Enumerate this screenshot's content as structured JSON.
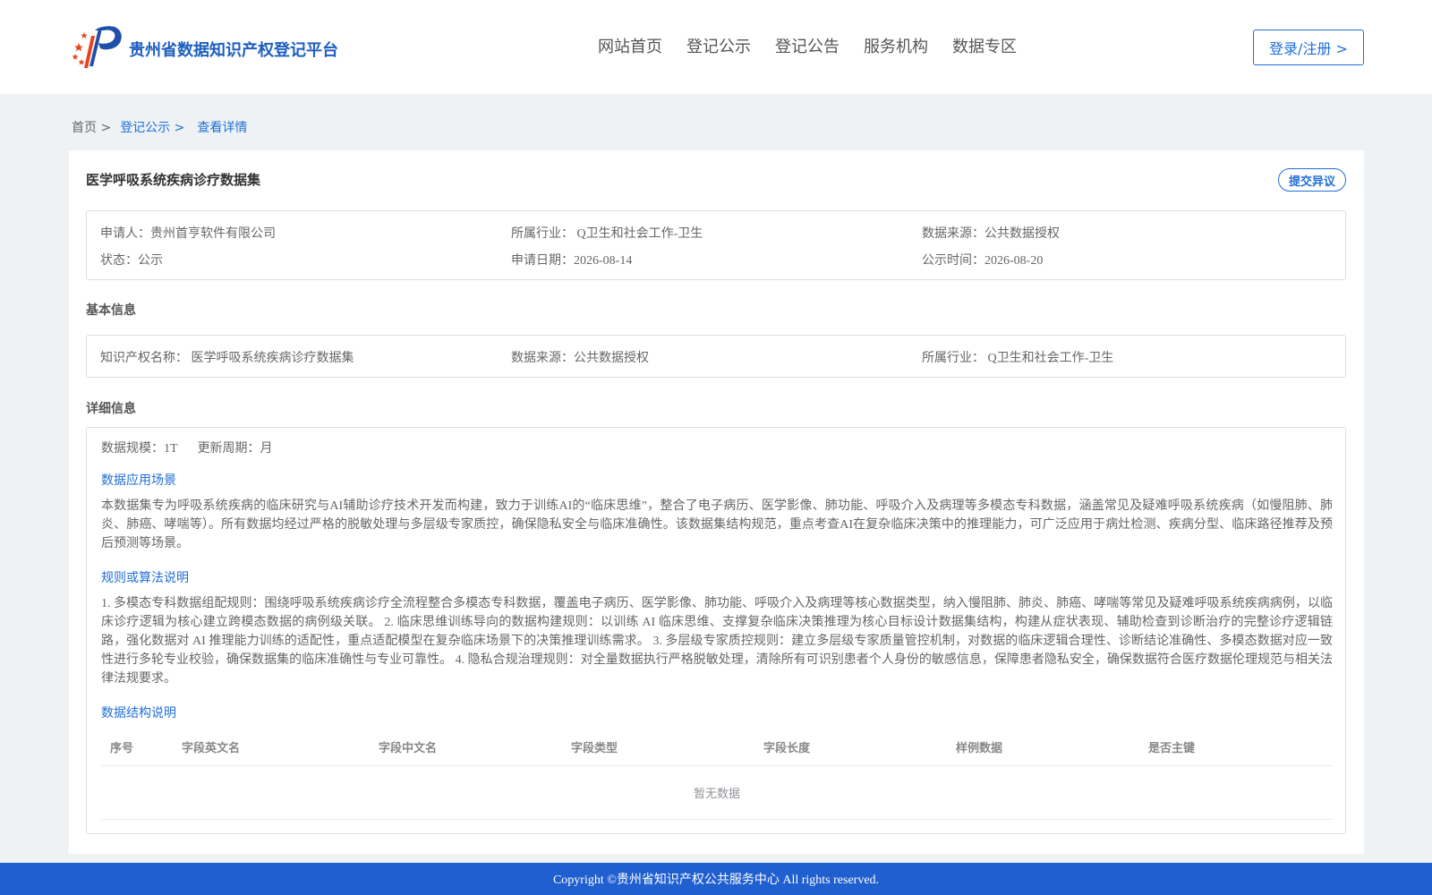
{
  "header": {
    "site_title": "贵州省数据知识产权登记平台",
    "nav": [
      "网站首页",
      "登记公示",
      "登记公告",
      "服务机构",
      "数据专区"
    ],
    "login_label": "登录/注册 >"
  },
  "breadcrumb": {
    "home": "首页 >",
    "level1": "登记公示 >",
    "current": "查看详情"
  },
  "detail": {
    "title": "医学呼吸系统疾病诊疗数据集",
    "objection_label": "提交异议",
    "summary": {
      "applicant": "申请人：贵州首亨软件有限公司",
      "industry": "所属行业： Q卫生和社会工作-卫生",
      "source": "数据来源：公共数据授权",
      "status": "状态：公示",
      "apply_date": "申请日期：2026-08-14",
      "publish_time": "公示时间：2026-08-20"
    },
    "basic_title": "基本信息",
    "basic": {
      "ip_name": "知识产权名称： 医学呼吸系统疾病诊疗数据集",
      "source": "数据来源：公共数据授权",
      "industry": "所属行业： Q卫生和社会工作-卫生"
    },
    "detail_title": "详细信息",
    "scale": "数据规模：1T",
    "cycle": "更新周期：月",
    "scenario_title": "数据应用场景",
    "scenario_text": "本数据集专为呼吸系统疾病的临床研究与AI辅助诊疗技术开发而构建，致力于训练AI的“临床思维”，整合了电子病历、医学影像、肺功能、呼吸介入及病理等多模态专科数据，涵盖常见及疑难呼吸系统疾病（如慢阻肺、肺炎、肺癌、哮喘等）。所有数据均经过严格的脱敏处理与多层级专家质控，确保隐私安全与临床准确性。该数据集结构规范，重点考查AI在复杂临床决策中的推理能力，可广泛应用于病灶检测、疾病分型、临床路径推荐及预后预测等场景。",
    "rules_title": "规则或算法说明",
    "rules_text": "1. 多模态专科数据组配规则：围绕呼吸系统疾病诊疗全流程整合多模态专科数据，覆盖电子病历、医学影像、肺功能、呼吸介入及病理等核心数据类型，纳入慢阻肺、肺炎、肺癌、哮喘等常见及疑难呼吸系统疾病病例，以临床诊疗逻辑为核心建立跨模态数据的病例级关联。 2. 临床思维训练导向的数据构建规则：以训练 AI 临床思维、支撑复杂临床决策推理为核心目标设计数据集结构，构建从症状表现、辅助检查到诊断治疗的完整诊疗逻辑链路，强化数据对 AI 推理能力训练的适配性，重点适配模型在复杂临床场景下的决策推理训练需求。 3. 多层级专家质控规则：建立多层级专家质量管控机制，对数据的临床逻辑合理性、诊断结论准确性、多模态数据对应一致性进行多轮专业校验，确保数据集的临床准确性与专业可靠性。 4. 隐私合规治理规则：对全量数据执行严格脱敏处理，清除所有可识别患者个人身份的敏感信息，保障患者隐私安全，确保数据符合医疗数据伦理规范与相关法律法规要求。",
    "structure_title": "数据结构说明",
    "table_headers": [
      "序号",
      "字段英文名",
      "字段中文名",
      "字段类型",
      "字段长度",
      "样例数据",
      "是否主键"
    ],
    "table_empty": "暂无数据"
  },
  "footer": "Copyright ©贵州省知识产权公共服务中心 All rights reserved.",
  "colors": {
    "brand_blue": "#1f6fd6",
    "footer_blue": "#1f5fcf",
    "page_bg": "#eef2f5"
  }
}
